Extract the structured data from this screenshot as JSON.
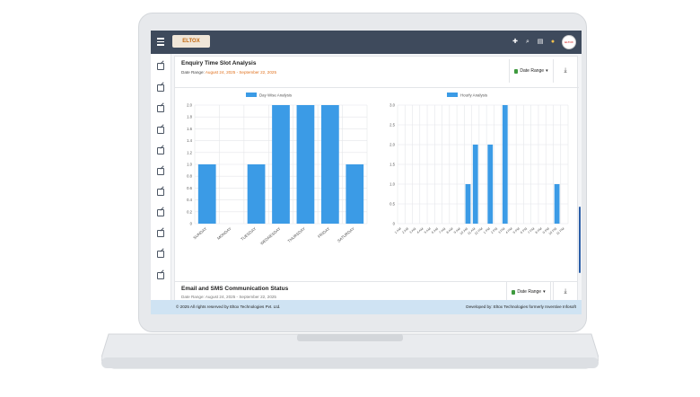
{
  "header": {
    "logo_text": "ELTOX",
    "icons": [
      "plus-icon",
      "search-icon",
      "document-icon",
      "user-icon"
    ],
    "avatar_text": "ELTOX"
  },
  "sidebar": {
    "icons": [
      "edit-icon",
      "edit-icon",
      "edit-icon",
      "edit-icon",
      "document-icon",
      "edit-icon",
      "clipboard-icon",
      "edit-icon",
      "edit-icon",
      "edit-icon",
      "mail-icon"
    ]
  },
  "card1": {
    "title": "Enquiry Time Slot Analysis",
    "subtitle_prefix": "Date Range: ",
    "subtitle_range": "August 24, 2025 - September 22, 2025",
    "date_button": "Date Range",
    "download_icon": "download-icon"
  },
  "card2": {
    "title": "Email and SMS Communication Status",
    "subtitle": "Date Range: August 24, 2025 - September 22, 2025",
    "date_button": "Date Range",
    "download_icon": "download-icon"
  },
  "footer": {
    "left": "© 2025 All rights reserved by Eltox Technologies Pvt. Ltd.",
    "right": "Developed by: Eltox Technologies formerly Inventive Infosoft"
  },
  "colors": {
    "bar": "#3b9be6",
    "topbar": "#3e4a5c",
    "footer": "#cfe3f3",
    "accent": "#e0701c"
  },
  "chart_data": [
    {
      "type": "bar",
      "legend": "Day Wise Analysis",
      "categories": [
        "SUNDAY",
        "MONDAY",
        "TUESDAY",
        "WEDNESDAY",
        "THURSDAY",
        "FRIDAY",
        "SATURDAY"
      ],
      "values": [
        1,
        0,
        1,
        2,
        2,
        2,
        1
      ],
      "yticks": [
        "0",
        "0.2",
        "0.4",
        "0.6",
        "0.8",
        "1.0",
        "1.2",
        "1.4",
        "1.6",
        "1.8",
        "2.0"
      ],
      "ylim": [
        0,
        2
      ],
      "grid": true,
      "legend_position": "top"
    },
    {
      "type": "bar",
      "legend": "Hourly Analysis",
      "categories": [
        "1 AM",
        "2 AM",
        "3 AM",
        "4 AM",
        "5 AM",
        "6 AM",
        "7 AM",
        "8 AM",
        "9 AM",
        "10 AM",
        "11 AM",
        "12 PM",
        "1 PM",
        "2 PM",
        "3 PM",
        "4 PM",
        "5 PM",
        "6 PM",
        "7 PM",
        "8 PM",
        "9 PM",
        "10 PM",
        "11 PM"
      ],
      "values": [
        0,
        0,
        0,
        0,
        0,
        0,
        0,
        0,
        0,
        1,
        2,
        0,
        2,
        0,
        3,
        0,
        0,
        0,
        0,
        0,
        0,
        1,
        0
      ],
      "yticks": [
        "0",
        "0.5",
        "1.0",
        "1.5",
        "2.0",
        "2.5",
        "3.0"
      ],
      "ylim": [
        0,
        3
      ],
      "grid": true,
      "legend_position": "top"
    }
  ]
}
